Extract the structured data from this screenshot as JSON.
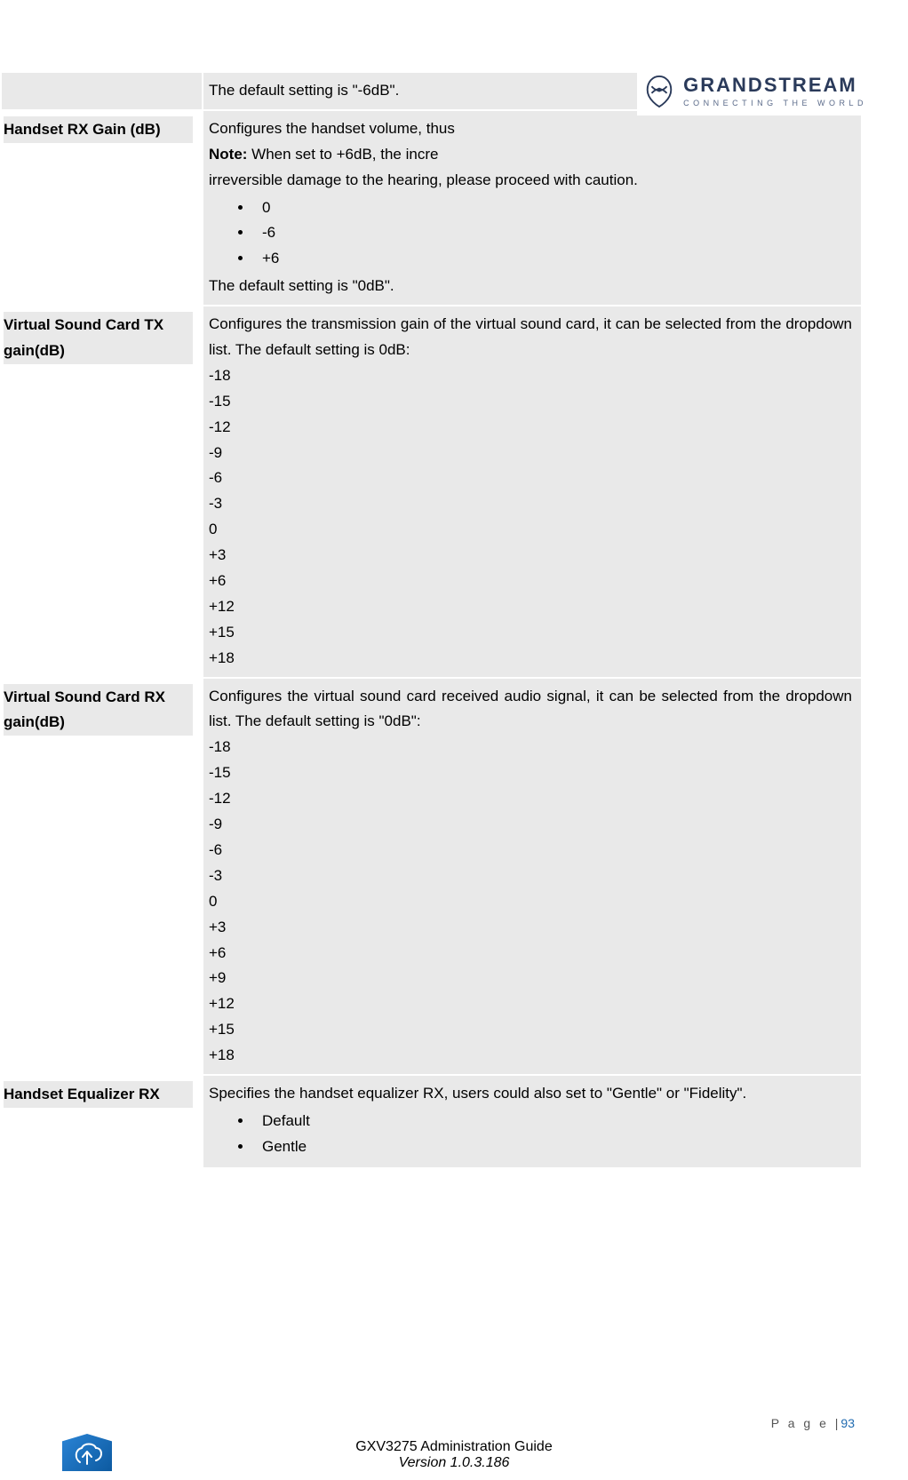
{
  "header": {
    "brand": "GRANDSTREAM",
    "tagline": "CONNECTING THE WORLD"
  },
  "rows": [
    {
      "label": "",
      "desc_default_only": "The default setting is \"-6dB\"."
    },
    {
      "label": "Handset RX Gain (dB)",
      "desc_line1": "Configures the handset volume, thus",
      "note_prefix": "Note:",
      "note_rest": " When set to +6dB, the incre",
      "desc_line2b": "irreversible damage to the hearing, please proceed with caution.",
      "options": [
        "0",
        "-6",
        "+6"
      ],
      "default_line": "The default setting is \"0dB\"."
    },
    {
      "label": "Virtual Sound Card TX gain(dB)",
      "desc": "Configures the transmission gain of the virtual sound card, it can be selected from the dropdown list. The default setting is 0dB:",
      "values": [
        "-18",
        "-15",
        "-12",
        "-9",
        "-6",
        "-3",
        "0",
        "+3",
        "+6",
        "+12",
        "+15",
        "+18"
      ]
    },
    {
      "label": "Virtual Sound Card RX gain(dB)",
      "desc": "Configures the virtual sound card received audio signal, it can be selected from the dropdown list. The default setting is \"0dB\":",
      "values": [
        "-18",
        "-15",
        "-12",
        "-9",
        "-6",
        "-3",
        "0",
        "+3",
        "+6",
        "+9",
        "+12",
        "+15",
        "+18"
      ]
    },
    {
      "label": "Handset Equalizer RX",
      "desc": "Specifies the handset equalizer RX, users could also set to \"Gentle\" or \"Fidelity\".",
      "options": [
        "Default",
        "Gentle"
      ]
    }
  ],
  "footer": {
    "page_label": "P a g e  |",
    "page_num": "93",
    "doc_title": "GXV3275 Administration Guide",
    "doc_version": "Version 1.0.3.186"
  }
}
